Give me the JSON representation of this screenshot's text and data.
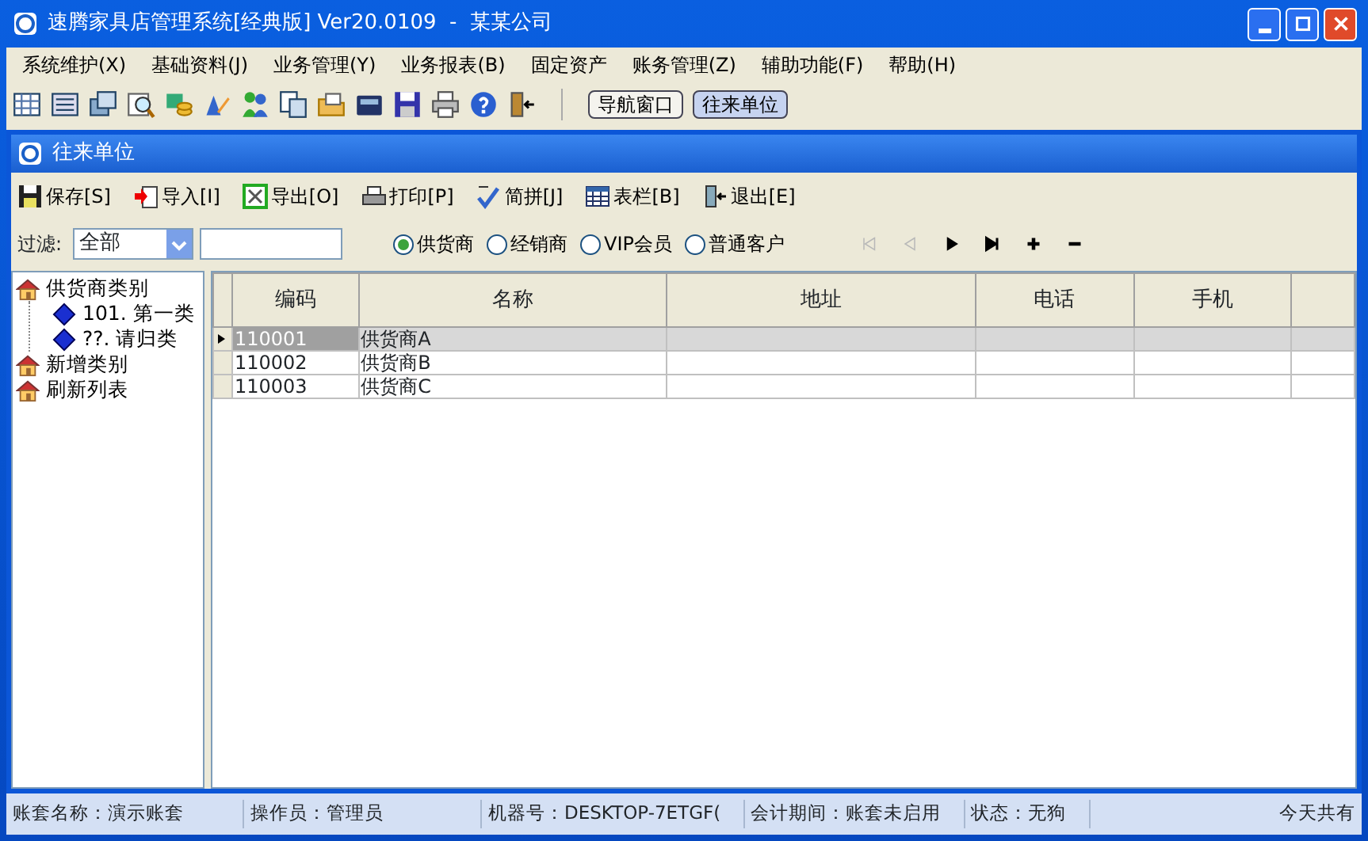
{
  "window": {
    "title": "速腾家具店管理系统[经典版] Ver20.0109  -  某某公司"
  },
  "menu": [
    {
      "label": "系统维护(X)"
    },
    {
      "label": "基础资料(J)"
    },
    {
      "label": "业务管理(Y)"
    },
    {
      "label": "业务报表(B)"
    },
    {
      "label": "固定资产"
    },
    {
      "label": "账务管理(Z)"
    },
    {
      "label": "辅助功能(F)"
    },
    {
      "label": "帮助(H)"
    }
  ],
  "quick_buttons": [
    {
      "label": "导航窗口",
      "selected": false
    },
    {
      "label": "往来单位",
      "selected": true
    }
  ],
  "child_window": {
    "title": "往来单位"
  },
  "toolbar": [
    {
      "label": "保存[S]",
      "kind": "save"
    },
    {
      "label": "导入[I]",
      "kind": "import"
    },
    {
      "label": "导出[O]",
      "kind": "export"
    },
    {
      "label": "打印[P]",
      "kind": "print"
    },
    {
      "label": "简拼[J]",
      "kind": "pinyin"
    },
    {
      "label": "表栏[B]",
      "kind": "columns"
    },
    {
      "label": "退出[E]",
      "kind": "exit"
    }
  ],
  "filter": {
    "label": "过滤:",
    "value": "全部"
  },
  "types": [
    {
      "label": "供货商",
      "selected": true
    },
    {
      "label": "经销商",
      "selected": false
    },
    {
      "label": "VIP会员",
      "selected": false
    },
    {
      "label": "普通客户",
      "selected": false
    }
  ],
  "nav": [
    {
      "kind": "first",
      "disabled": true
    },
    {
      "kind": "prev",
      "disabled": true
    },
    {
      "kind": "next",
      "disabled": false
    },
    {
      "kind": "last",
      "disabled": false
    },
    {
      "kind": "add",
      "disabled": false
    },
    {
      "kind": "remove",
      "disabled": false
    }
  ],
  "tree": [
    {
      "label": "供货商类别",
      "children": [
        {
          "label": "101. 第一类"
        },
        {
          "label": "??. 请归类"
        }
      ]
    },
    {
      "label": "新增类别"
    },
    {
      "label": "刷新列表"
    }
  ],
  "table": {
    "columns": [
      "编码",
      "名称",
      "地址",
      "电话",
      "手机"
    ],
    "rows": [
      {
        "selected": true,
        "cells": [
          "110001",
          "供货商A",
          "",
          "",
          ""
        ]
      },
      {
        "selected": false,
        "cells": [
          "110002",
          "供货商B",
          "",
          "",
          ""
        ]
      },
      {
        "selected": false,
        "cells": [
          "110003",
          "供货商C",
          "",
          "",
          ""
        ]
      }
    ]
  },
  "status_bar": [
    "账套名称：演示账套",
    "操作员：管理员",
    "机器号：DESKTOP-7ETGF(",
    "会计期间：账套未启用",
    "状态：无狗",
    "今天共有"
  ]
}
